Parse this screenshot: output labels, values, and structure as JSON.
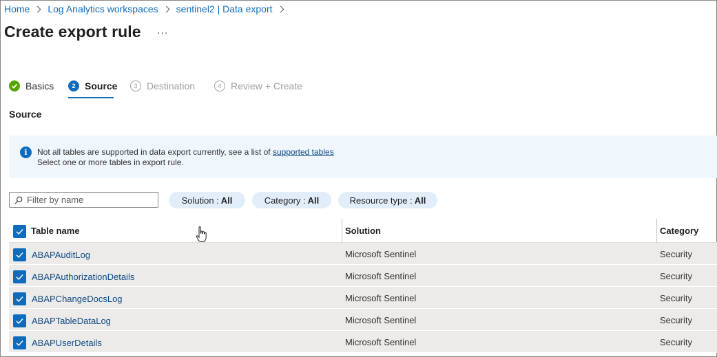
{
  "breadcrumb": [
    {
      "label": "Home"
    },
    {
      "label": "Log Analytics workspaces"
    },
    {
      "label": "sentinel2 | Data export"
    }
  ],
  "page": {
    "title": "Create export rule",
    "more_label": "..."
  },
  "steps": [
    {
      "label": "Basics",
      "number": "",
      "state": "done",
      "icon": "checkmark-icon"
    },
    {
      "label": "Source",
      "number": "2",
      "state": "current"
    },
    {
      "label": "Destination",
      "number": "3",
      "state": "todo"
    },
    {
      "label": "Review + Create",
      "number": "4",
      "state": "todo"
    }
  ],
  "section": {
    "title": "Source"
  },
  "info": {
    "line1": "Not all tables are supported in data export currently, see a list of ",
    "link": "supported tables",
    "line2": "Select one or more tables in export rule.",
    "icon": "info-icon"
  },
  "filter": {
    "placeholder": "Filter by name",
    "value": "",
    "icon": "search-icon"
  },
  "pills": [
    {
      "label": "Solution : ",
      "value": "All"
    },
    {
      "label": "Category : ",
      "value": "All"
    },
    {
      "label": "Resource type : ",
      "value": "All"
    }
  ],
  "table": {
    "columns": [
      "Table name",
      "Solution",
      "Category"
    ],
    "all_selected": true,
    "rows": [
      {
        "name": "ABAPAuditLog",
        "solution": "Microsoft Sentinel",
        "category": "Security",
        "selected": true
      },
      {
        "name": "ABAPAuthorizationDetails",
        "solution": "Microsoft Sentinel",
        "category": "Security",
        "selected": true
      },
      {
        "name": "ABAPChangeDocsLog",
        "solution": "Microsoft Sentinel",
        "category": "Security",
        "selected": true
      },
      {
        "name": "ABAPTableDataLog",
        "solution": "Microsoft Sentinel",
        "category": "Security",
        "selected": true
      },
      {
        "name": "ABAPUserDetails",
        "solution": "Microsoft Sentinel",
        "category": "Security",
        "selected": true
      }
    ]
  },
  "colors": {
    "accent": "#0f6cbd",
    "success": "#57a300",
    "info_background": "#eff6fc",
    "pill_background": "#e1eefa",
    "row_background": "#edebe9"
  }
}
